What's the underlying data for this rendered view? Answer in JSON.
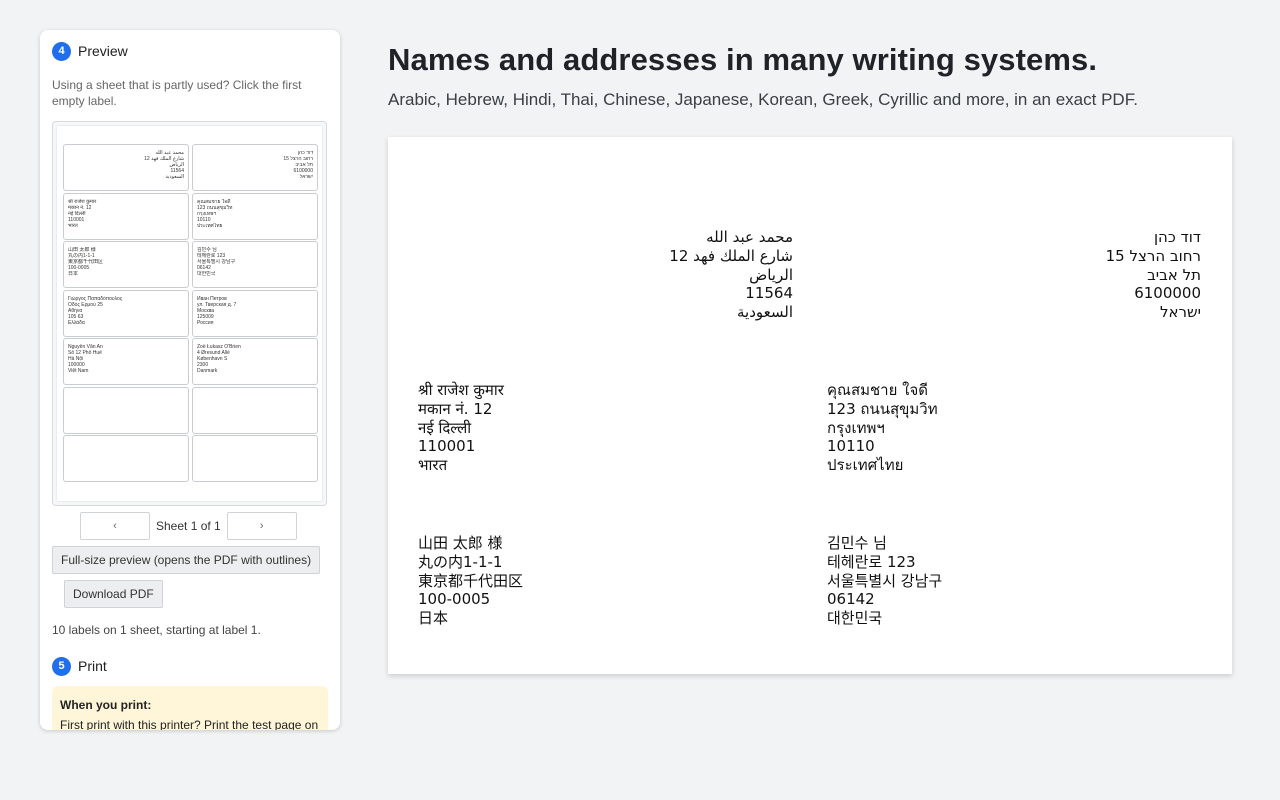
{
  "preview_step": {
    "number": "4",
    "title": "Preview",
    "hint": "Using a sheet that is partly used? Click the first empty label."
  },
  "labels": [
    {
      "lines": [
        "محمد عبد الله",
        "شارع الملك فهد 12",
        "الرياض",
        "11564",
        "السعودية"
      ],
      "dir": "rtl"
    },
    {
      "lines": [
        "דוד כהן",
        "רחוב הרצל 15",
        "תל אביב",
        "6100000",
        "ישראל"
      ],
      "dir": "rtl"
    },
    {
      "lines": [
        "श्री राजेश कुमार",
        "मकान नं. 12",
        "नई दिल्ली",
        "110001",
        "भारत"
      ],
      "dir": "ltr"
    },
    {
      "lines": [
        "คุณสมชาย ใจดี",
        "123 ถนนสุขุมวิท",
        "กรุงเทพฯ",
        "10110",
        "ประเทศไทย"
      ],
      "dir": "ltr"
    },
    {
      "lines": [
        "山田 太郎 様",
        "丸の内1-1-1",
        "東京都千代田区",
        "100-0005",
        "日本"
      ],
      "dir": "ltr"
    },
    {
      "lines": [
        "김민수 님",
        "테헤란로 123",
        "서울특별시 강남구",
        "06142",
        "대한민국"
      ],
      "dir": "ltr"
    },
    {
      "lines": [
        "Γιώργος Παπαδόπουλος",
        "Οδός Ερμού 25",
        "Αθήνα",
        "105 63",
        "Ελλάδα"
      ],
      "dir": "ltr"
    },
    {
      "lines": [
        "Иван Петров",
        "ул. Тверская д. 7",
        "Москва",
        "125009",
        "Россия"
      ],
      "dir": "ltr"
    },
    {
      "lines": [
        "Nguyễn Văn An",
        "Số 12 Phố Huế",
        "Hà Nội",
        "100000",
        "Việt Nam"
      ],
      "dir": "ltr"
    },
    {
      "lines": [
        "Zoë Łukasz O'Brien",
        "4 Øresund Allé",
        "København S",
        "2300",
        "Danmark"
      ],
      "dir": "ltr"
    },
    {
      "lines": [],
      "dir": "ltr"
    },
    {
      "lines": [],
      "dir": "ltr"
    },
    {
      "lines": [],
      "dir": "ltr"
    },
    {
      "lines": [],
      "dir": "ltr"
    }
  ],
  "pager": {
    "prev": "‹",
    "next": "›",
    "status": "Sheet 1 of 1"
  },
  "buttons": {
    "full_preview": "Full-size preview (opens the PDF with outlines)",
    "download": "Download PDF"
  },
  "summary": "10 labels on 1 sheet, starting at label 1.",
  "print_step": {
    "number": "5",
    "title": "Print",
    "notice_title": "When you print:",
    "notice_text": "First print with this printer? Print the test page on"
  },
  "main": {
    "headline": "Names and addresses in many writing systems.",
    "subline": "Arabic, Hebrew, Hindi, Thai, Chinese, Japanese, Korean, Greek, Cyrillic and more, in an exact PDF."
  },
  "colors": {
    "accent": "#1f6feb",
    "notice_bg": "#fff6d9",
    "page_bg": "#f1f3f5"
  }
}
